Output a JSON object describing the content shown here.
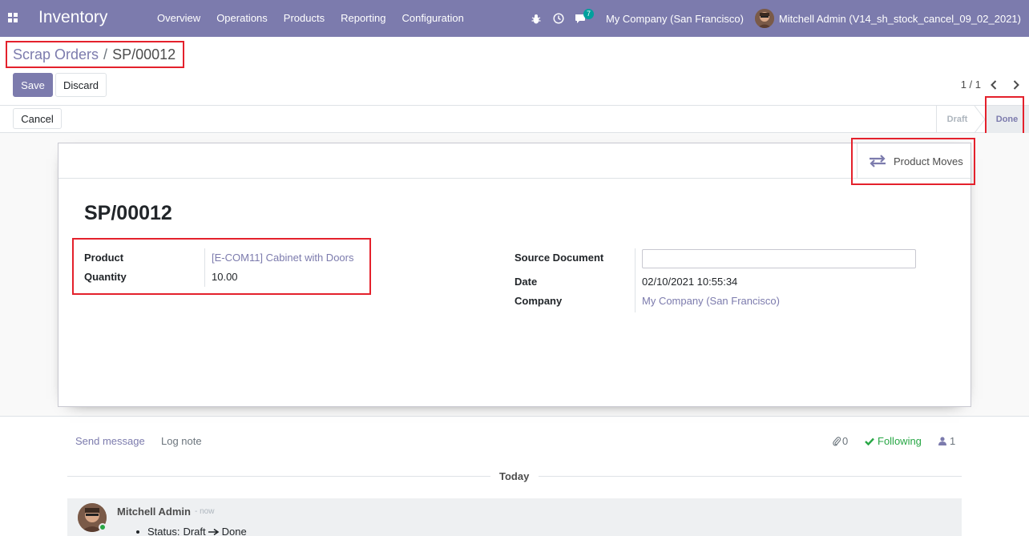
{
  "navbar": {
    "brand": "Inventory",
    "menu": [
      "Overview",
      "Operations",
      "Products",
      "Reporting",
      "Configuration"
    ],
    "message_count": "7",
    "company": "My Company (San Francisco)",
    "user": "Mitchell Admin (V14_sh_stock_cancel_09_02_2021)"
  },
  "breadcrumb": {
    "parent": "Scrap Orders",
    "separator": "/",
    "current": "SP/00012"
  },
  "buttons": {
    "save": "Save",
    "discard": "Discard",
    "cancel": "Cancel"
  },
  "pager": {
    "value": "1 / 1"
  },
  "statusbar": {
    "stages": [
      "Draft",
      "Done"
    ],
    "active": "Done"
  },
  "sheet": {
    "smart_button": "Product Moves",
    "title": "SP/00012",
    "left_fields": [
      {
        "label": "Product",
        "value": "[E-COM11] Cabinet with Doors"
      },
      {
        "label": "Quantity",
        "value": "10.00"
      }
    ],
    "right_fields": [
      {
        "label": "Source Document",
        "value": ""
      },
      {
        "label": "Date",
        "value": "02/10/2021 10:55:34"
      },
      {
        "label": "Company",
        "value": "My Company (San Francisco)"
      }
    ]
  },
  "chatter": {
    "send_message": "Send message",
    "log_note": "Log note",
    "attachments": "0",
    "following": "Following",
    "followers": "1",
    "date_separator": "Today",
    "message": {
      "author": "Mitchell Admin",
      "time": "- now",
      "tracking_field": "Status:",
      "old_value": "Draft",
      "new_value": "Done"
    }
  },
  "colors": {
    "brand": "#7c7bad",
    "highlight": "#e4212c",
    "following": "#28a745"
  }
}
